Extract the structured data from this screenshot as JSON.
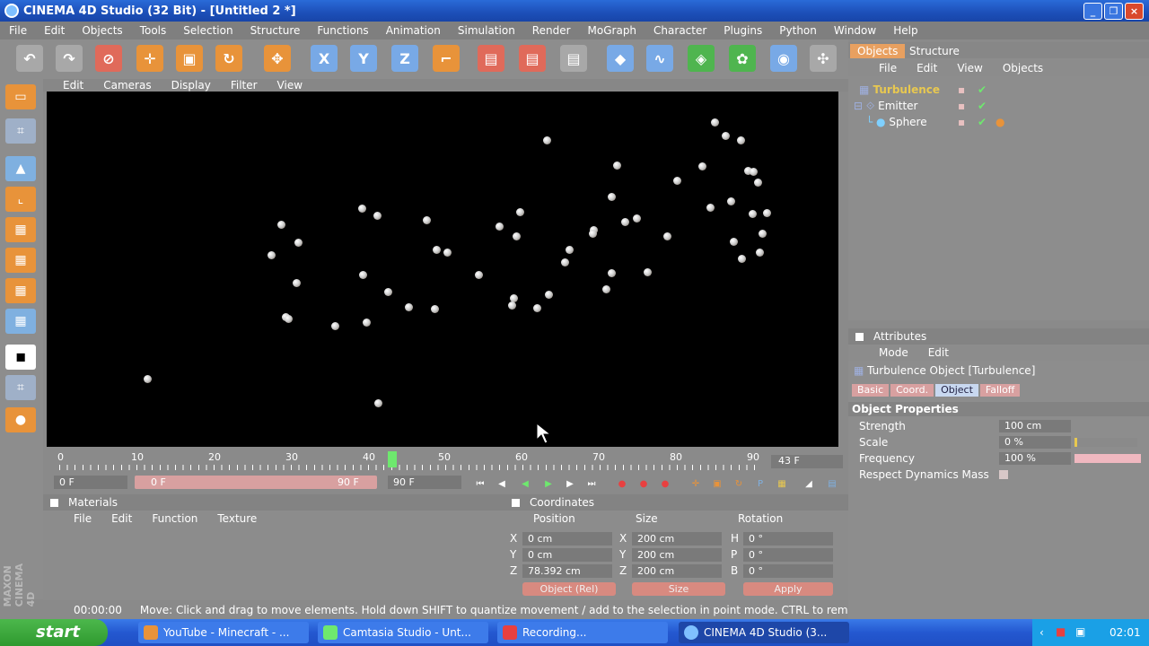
{
  "window": {
    "title": "CINEMA 4D Studio (32 Bit) - [Untitled 2 *]"
  },
  "menu": [
    "File",
    "Edit",
    "Objects",
    "Tools",
    "Selection",
    "Structure",
    "Functions",
    "Animation",
    "Simulation",
    "Render",
    "MoGraph",
    "Character",
    "Plugins",
    "Python",
    "Window",
    "Help"
  ],
  "viewport": {
    "menu": [
      "Edit",
      "Cameras",
      "Display",
      "Filter",
      "View"
    ]
  },
  "timeline": {
    "labels": [
      "0",
      "10",
      "20",
      "30",
      "40",
      "50",
      "60",
      "70",
      "80",
      "90"
    ],
    "current_frame": "43 F",
    "start_frame": "0 F",
    "range_start": "0 F",
    "range_end": "90 F",
    "end_frame": "90 F"
  },
  "materials": {
    "title": "Materials",
    "menu": [
      "File",
      "Edit",
      "Function",
      "Texture"
    ]
  },
  "coordinates": {
    "title": "Coordinates",
    "headers": [
      "Position",
      "Size",
      "Rotation"
    ],
    "rows": [
      {
        "axis": "X",
        "pos": "0 cm",
        "saxis": "X",
        "size": "200 cm",
        "raxis": "H",
        "rot": "0 °"
      },
      {
        "axis": "Y",
        "pos": "0 cm",
        "saxis": "Y",
        "size": "200 cm",
        "raxis": "P",
        "rot": "0 °"
      },
      {
        "axis": "Z",
        "pos": "78.392 cm",
        "saxis": "Z",
        "size": "200 cm",
        "raxis": "B",
        "rot": "0 °"
      }
    ],
    "mode": "Object (Rel)",
    "size_mode": "Size",
    "apply": "Apply"
  },
  "status": {
    "time": "00:00:00",
    "message": "Move: Click and drag to move elements. Hold down SHIFT to quantize movement / add to the selection in point mode. CTRL to remov"
  },
  "objects_panel": {
    "tabs": [
      "Objects",
      "Structure"
    ],
    "menu": [
      "File",
      "Edit",
      "View",
      "Objects"
    ],
    "items": [
      {
        "name": "Turbulence",
        "selected": true
      },
      {
        "name": "Emitter",
        "selected": false
      },
      {
        "name": "Sphere",
        "selected": false
      }
    ]
  },
  "attributes": {
    "title": "Attributes",
    "menu": [
      "Mode",
      "Edit"
    ],
    "object_title": "Turbulence Object [Turbulence]",
    "tabs": [
      "Basic",
      "Coord.",
      "Object",
      "Falloff"
    ],
    "active_tab": "Object",
    "section": "Object Properties",
    "props": [
      {
        "label": "Strength",
        "value": "100 cm"
      },
      {
        "label": "Scale",
        "value": "0 %"
      },
      {
        "label": "Frequency",
        "value": "100 %"
      }
    ],
    "checkbox_label": "Respect Dynamics Mass"
  },
  "taskbar": {
    "start": "start",
    "tasks": [
      "YouTube - Minecraft - ...",
      "Camtasia Studio - Unt...",
      "Recording...",
      "CINEMA 4D Studio (3..."
    ],
    "clock": "02:01"
  },
  "colors": {
    "accent": "#e8a060",
    "selection": "#e8c850",
    "taskbar": "#2458d0"
  }
}
